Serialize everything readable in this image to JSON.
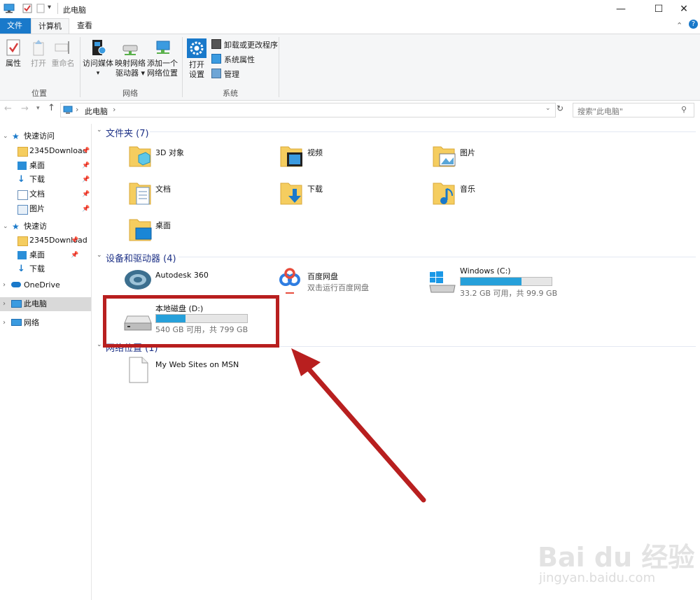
{
  "window": {
    "title": "此电脑",
    "minimize": "—",
    "maximize": "☐",
    "close": "✕"
  },
  "tabs": [
    {
      "label": "文件"
    },
    {
      "label": "计算机"
    },
    {
      "label": "查看"
    }
  ],
  "ribbon": {
    "location": {
      "group": "位置",
      "buttons": [
        {
          "label": "属性"
        },
        {
          "label": "打开"
        },
        {
          "label": "重命名"
        }
      ]
    },
    "network": {
      "group": "网络",
      "buttons": [
        {
          "label1": "访问媒体",
          "label2": "▾"
        },
        {
          "label1": "映射网络",
          "label2": "驱动器 ▾"
        },
        {
          "label1": "添加一个",
          "label2": "网络位置"
        }
      ]
    },
    "system": {
      "group": "系统",
      "open_label1": "打开",
      "open_label2": "设置",
      "small": [
        {
          "label": "卸载或更改程序"
        },
        {
          "label": "系统属性"
        },
        {
          "label": "管理"
        }
      ]
    }
  },
  "address": {
    "path": "此电脑",
    "sep": "›",
    "search_placeholder": "搜索\"此电脑\""
  },
  "nav": {
    "items": [
      {
        "label": "快速访问"
      },
      {
        "label": "2345Download"
      },
      {
        "label": "桌面"
      },
      {
        "label": "下载"
      },
      {
        "label": "文档"
      },
      {
        "label": "图片"
      },
      {
        "label": "快速访"
      },
      {
        "label": "2345Download"
      },
      {
        "label": "桌面"
      },
      {
        "label": "下载"
      },
      {
        "label": "OneDrive"
      },
      {
        "label": "此电脑"
      },
      {
        "label": "网络"
      }
    ]
  },
  "content": {
    "folders_header": "文件夹 (7)",
    "folders": [
      {
        "label": "3D 对象"
      },
      {
        "label": "视频"
      },
      {
        "label": "图片"
      },
      {
        "label": "文档"
      },
      {
        "label": "下载"
      },
      {
        "label": "音乐"
      },
      {
        "label": "桌面"
      }
    ],
    "devices_header": "设备和驱动器 (4)",
    "devices": [
      {
        "label": "Autodesk 360"
      },
      {
        "label": "百度网盘",
        "sub": "双击运行百度网盘"
      },
      {
        "label": "Windows (C:)",
        "sub": "33.2 GB 可用，共 99.9 GB",
        "used_fraction": 0.67
      },
      {
        "label": "本地磁盘 (D:)",
        "sub": "540 GB 可用，共 799 GB",
        "used_fraction": 0.32
      }
    ],
    "network_header": "网络位置 (1)",
    "network": [
      {
        "label": "My Web Sites on MSN"
      }
    ]
  },
  "watermark": {
    "main": "Bai du 经验",
    "url": "jingyan.baidu.com"
  },
  "colors": {
    "accent": "#1979ca",
    "highlight": "#b81f1f",
    "drive_bar": "#26a0da"
  }
}
